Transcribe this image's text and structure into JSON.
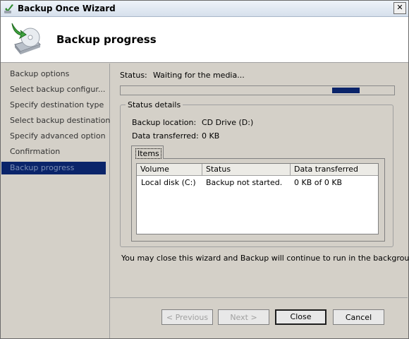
{
  "window": {
    "title": "Backup Once Wizard",
    "close_glyph": "✕"
  },
  "header": {
    "title": "Backup progress",
    "icon": "backup-drive-icon"
  },
  "nav": {
    "items": [
      {
        "label": "Backup options"
      },
      {
        "label": "Select backup configur..."
      },
      {
        "label": "Specify destination type"
      },
      {
        "label": "Select backup destination"
      },
      {
        "label": "Specify advanced option"
      },
      {
        "label": "Confirmation"
      },
      {
        "label": "Backup progress"
      }
    ]
  },
  "status": {
    "label": "Status:",
    "value": "Waiting for the media...",
    "progress": "marquee"
  },
  "details": {
    "title": "Status details",
    "location_label": "Backup location:",
    "location_value": "CD Drive (D:)",
    "transferred_label": "Data transferred:",
    "transferred_value": "0 KB",
    "tab_label": "Items",
    "columns": [
      "Volume",
      "Status",
      "Data transferred"
    ],
    "rows": [
      {
        "volume": "Local disk (C:)",
        "status": "Backup not started.",
        "transferred": "0 KB of 0 KB"
      }
    ]
  },
  "note": "You may close this wizard and Backup will continue to run in the background.",
  "buttons": {
    "previous": "< Previous",
    "next": "Next >",
    "close": "Close",
    "cancel": "Cancel"
  },
  "colors": {
    "accent": "#0a246a",
    "background": "#d4d0c8"
  }
}
